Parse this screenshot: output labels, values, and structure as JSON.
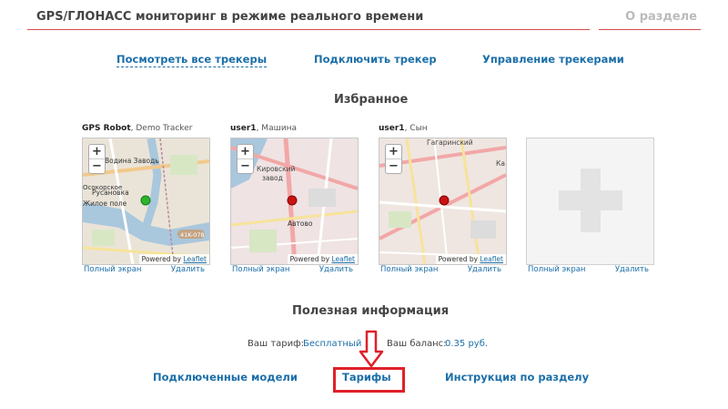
{
  "header": {
    "title": "GPS/ГЛОНАСС мониторинг в режиме реального времени",
    "about_link": "О разделе"
  },
  "top_nav": {
    "view_all": "Посмотреть все трекеры",
    "connect": "Подключить трекер",
    "manage": "Управление трекерами"
  },
  "favorites": {
    "title": "Избранное",
    "trackers": [
      {
        "user": "GPS Robot",
        "device": ", Demo Tracker",
        "marker": "green",
        "labels": [
          "Водина Заводь",
          "Русановка",
          "Осокорское",
          "Жилое поле",
          "41K-078"
        ]
      },
      {
        "user": "user1",
        "device": ", Машина",
        "marker": "red",
        "labels": [
          "Кировский",
          "завод",
          "Автово"
        ]
      },
      {
        "user": "user1",
        "device": ", Сын",
        "marker": "red",
        "labels": [
          "Гагаринский",
          "Ка"
        ]
      }
    ],
    "fullscreen_label": "Полный экран",
    "delete_label": "Удалить",
    "attribution": "Powered by",
    "attribution_link": "Leaflet",
    "zoom_in": "+",
    "zoom_out": "−"
  },
  "info": {
    "title": "Полезная информация",
    "tariff_label": "Ваш тариф:",
    "tariff_value": "Бесплатный",
    "balance_label": "Ваш баланс:",
    "balance_value": "0.35 руб."
  },
  "bottom_nav": {
    "models": "Подключенные модели",
    "tariffs": "Тарифы",
    "instructions": "Инструкция по разделу"
  },
  "colors": {
    "link": "#1c6fa8",
    "accent_line": "#d84a4a",
    "highlight": "#e0202a",
    "marker_green": "#2bb52b",
    "marker_red": "#cc1111"
  }
}
